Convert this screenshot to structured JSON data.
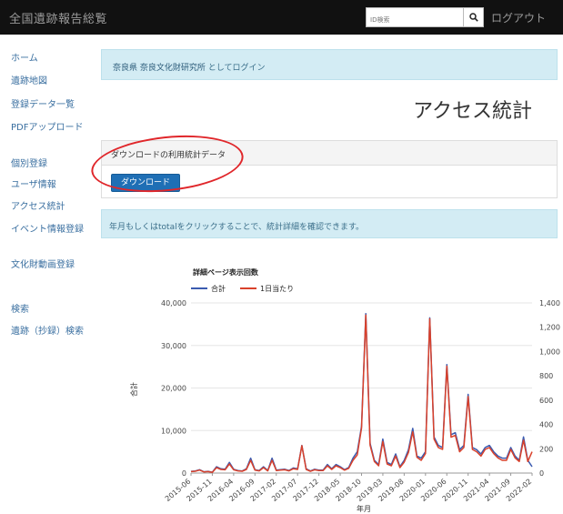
{
  "header": {
    "brand": "全国遺跡報告総覧",
    "search_placeholder": "ID検索",
    "logout": "ログアウト"
  },
  "sidebar": {
    "items": [
      {
        "label": "ホーム"
      },
      {
        "label": "遺跡地図"
      },
      {
        "label": "登録データ一覧"
      },
      {
        "label": "PDFアップロード"
      },
      {
        "label": "個別登録"
      },
      {
        "label": "ユーザ情報"
      },
      {
        "label": "アクセス統計"
      },
      {
        "label": "イベント情報登録"
      },
      {
        "label": "文化財動画登録"
      },
      {
        "label": "検索"
      },
      {
        "label": "遺跡（抄録）検索"
      }
    ]
  },
  "login_alert": {
    "org": "奈良県 奈良文化財研究所",
    "suffix": " としてログイン"
  },
  "page_title": "アクセス統計",
  "download_panel": {
    "heading": "ダウンロードの利用統計データ",
    "button": "ダウンロード"
  },
  "hint_alert": "年月もしくはtotalをクリックすることで、統計詳細を確認できます。",
  "colors": {
    "topbar": "#111111",
    "series_total": "#3b5bb0",
    "series_daily": "#d9412b",
    "annotation": "#e0262a",
    "alert_bg": "#d3ecf4"
  },
  "chart_data": {
    "type": "line",
    "title": "詳細ページ表示回数",
    "xlabel": "年月",
    "ylabel": "合計",
    "ylim": [
      0,
      40000
    ],
    "y2lim": [
      0,
      1400
    ],
    "yticks": [
      "0",
      "10,000",
      "20,000",
      "30,000",
      "40,000"
    ],
    "y2ticks": [
      "0",
      "200",
      "400",
      "600",
      "800",
      "1,000",
      "1,200",
      "1,400"
    ],
    "xticks": [
      "2015-06",
      "2015-11",
      "2016-04",
      "2016-09",
      "2017-02",
      "2017-07",
      "2017-12",
      "2018-05",
      "2018-10",
      "2019-03",
      "2019-08",
      "2020-01",
      "2020-06",
      "2020-11",
      "2021-04",
      "2021-09",
      "2022-02"
    ],
    "series": [
      {
        "name": "合計",
        "axis": "left",
        "values": [
          400,
          500,
          800,
          300,
          400,
          200,
          1500,
          1000,
          900,
          2500,
          900,
          600,
          500,
          1000,
          3500,
          800,
          600,
          1500,
          600,
          3500,
          700,
          800,
          900,
          600,
          1200,
          1000,
          6500,
          1000,
          500,
          900,
          700,
          700,
          2000,
          1000,
          2000,
          1500,
          800,
          1300,
          3500,
          5000,
          11000,
          37500,
          7000,
          3000,
          2000,
          8000,
          2500,
          2000,
          4500,
          1500,
          3000,
          5500,
          10500,
          4000,
          3500,
          5000,
          36500,
          8500,
          6500,
          6000,
          25500,
          9000,
          9500,
          5500,
          6500,
          18500,
          6000,
          5500,
          4500,
          6000,
          6500,
          5000,
          4000,
          3500,
          3500,
          6000,
          4000,
          3000,
          8500,
          3000,
          1500
        ]
      },
      {
        "name": "1日当たり",
        "axis": "right",
        "values": [
          12,
          15,
          25,
          10,
          12,
          6,
          45,
          30,
          27,
          75,
          27,
          18,
          15,
          30,
          105,
          24,
          18,
          45,
          18,
          105,
          21,
          24,
          27,
          18,
          36,
          30,
          225,
          30,
          15,
          27,
          21,
          21,
          60,
          30,
          60,
          45,
          24,
          39,
          105,
          150,
          370,
          1300,
          230,
          95,
          60,
          260,
          75,
          60,
          140,
          45,
          90,
          170,
          340,
          130,
          105,
          160,
          1270,
          280,
          210,
          195,
          880,
          295,
          310,
          175,
          210,
          630,
          195,
          175,
          140,
          195,
          210,
          160,
          125,
          105,
          105,
          195,
          125,
          95,
          270,
          95,
          175
        ]
      }
    ]
  }
}
